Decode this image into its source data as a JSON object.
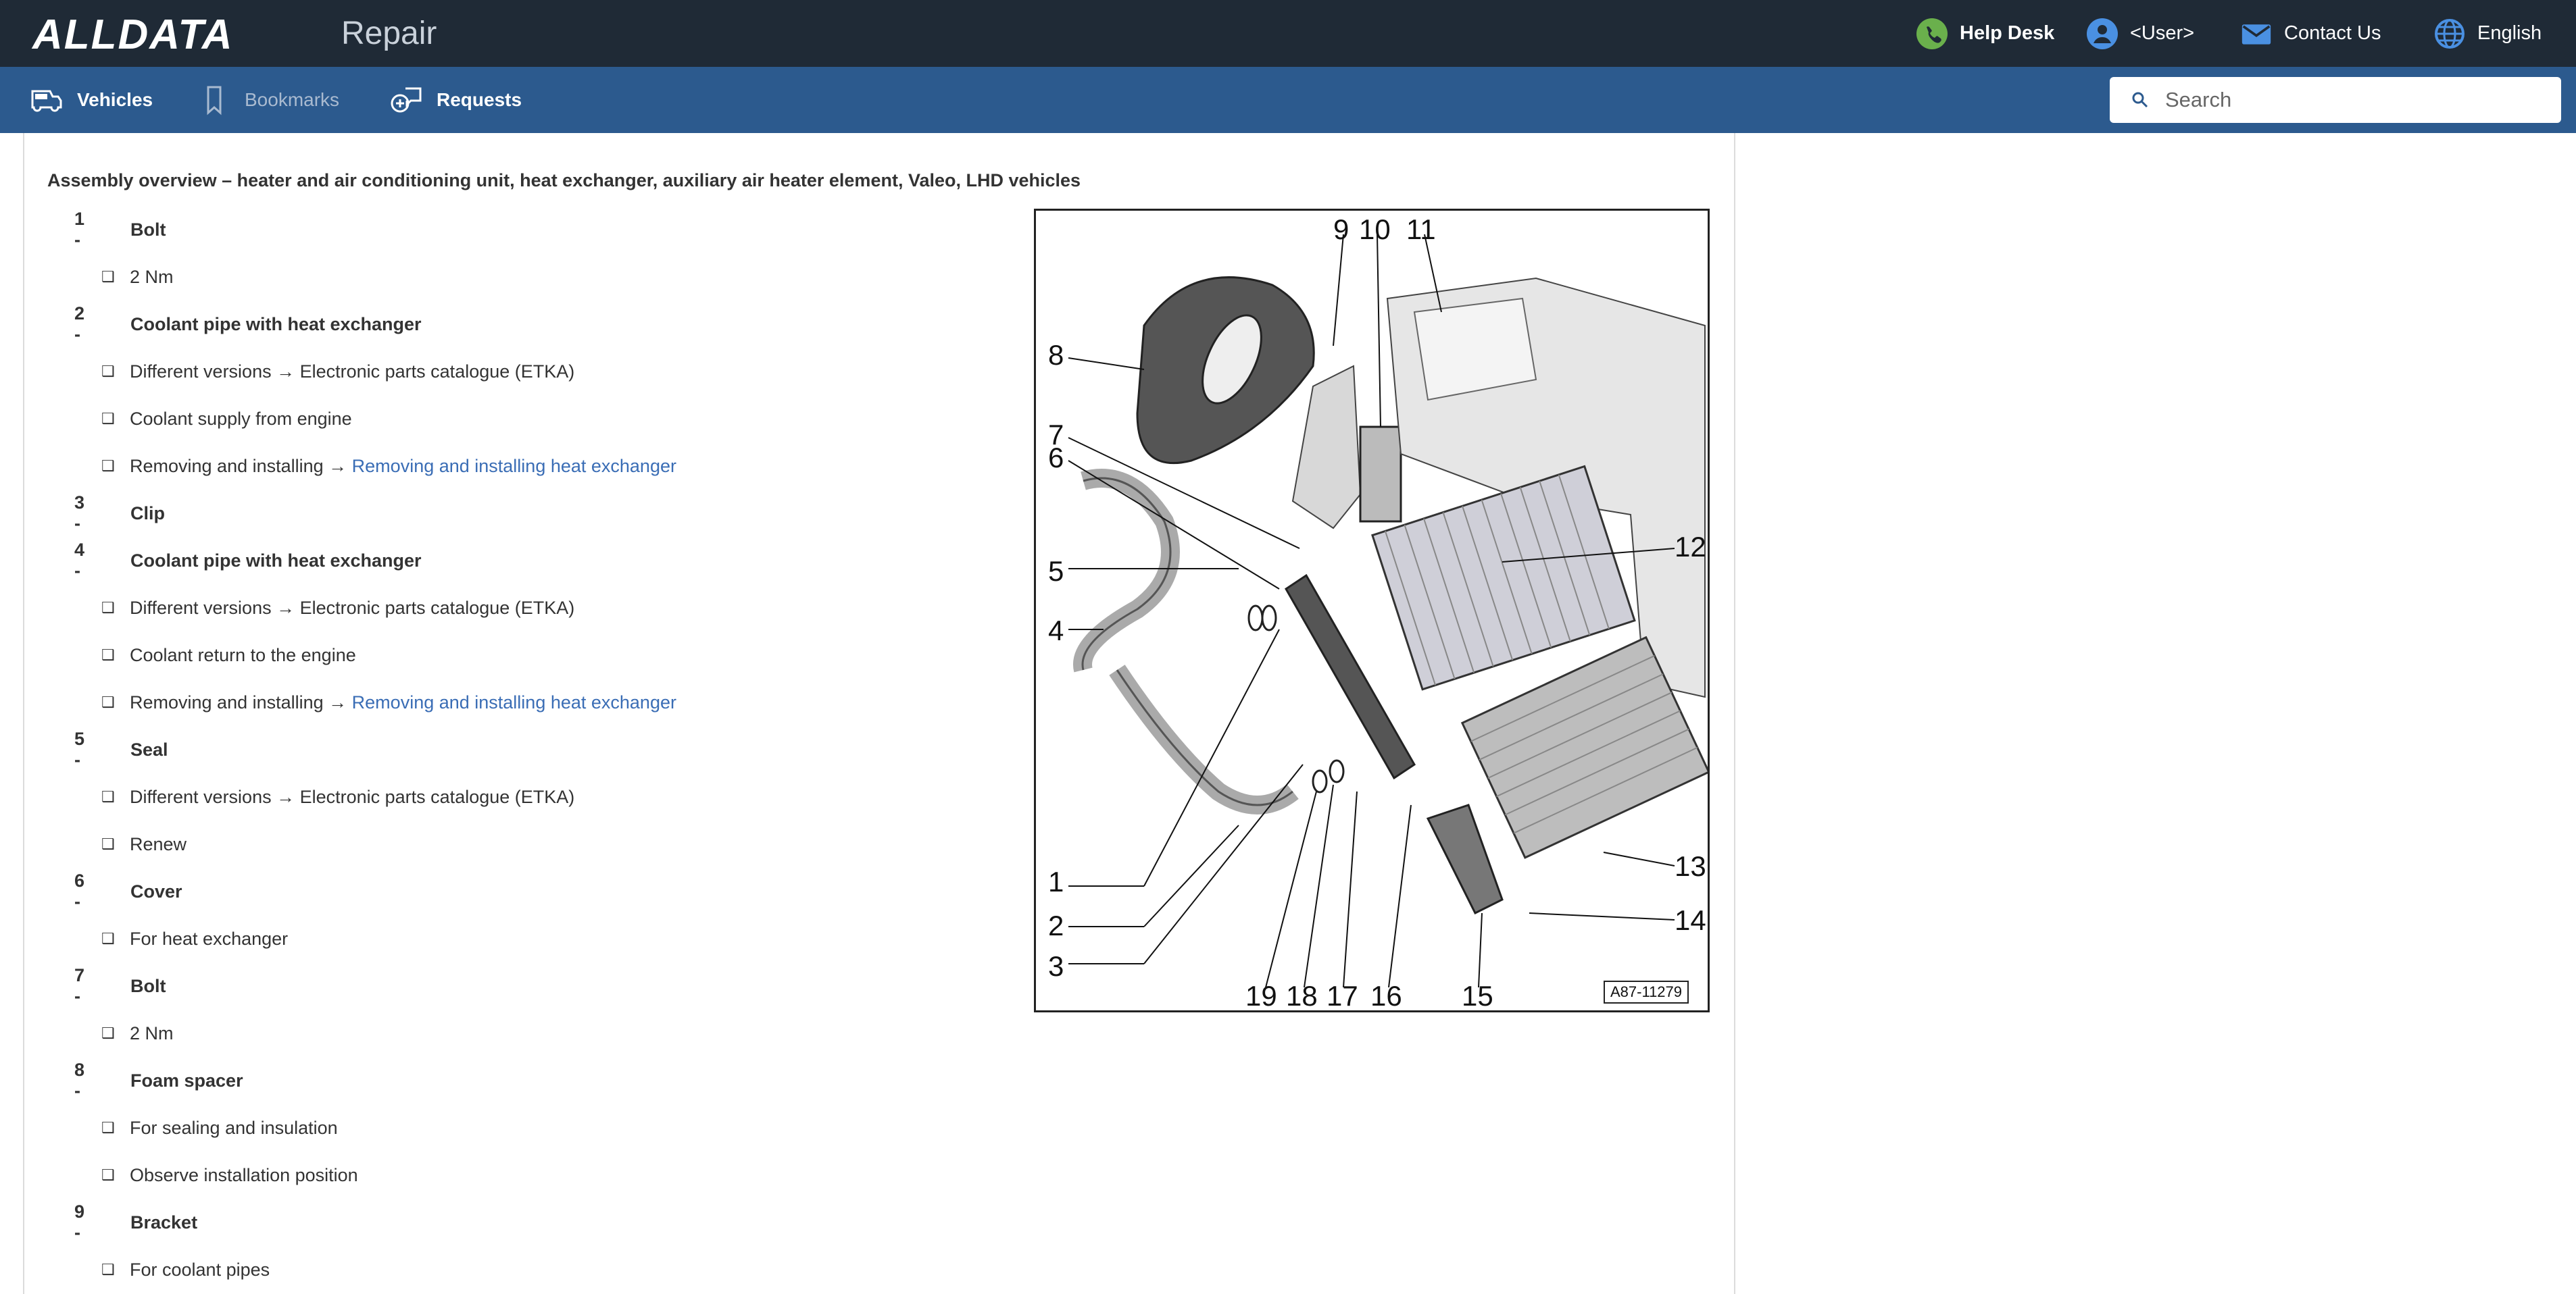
{
  "header": {
    "logo": "ALLDATA",
    "product": "Repair",
    "help_desk": "Help Desk",
    "user": "<User>",
    "contact_us": "Contact Us",
    "language": "English"
  },
  "nav": {
    "vehicles": "Vehicles",
    "bookmarks": "Bookmarks",
    "requests": "Requests",
    "search_placeholder": "Search"
  },
  "article": {
    "title": "Assembly overview – heater and air conditioning unit, heat exchanger, auxiliary air heater element, Valeo, LHD vehicles",
    "link_text": "Removing and installing heat exchanger",
    "items": [
      {
        "num": "1 -",
        "name": "Bolt",
        "subs": [
          "2 Nm"
        ]
      },
      {
        "num": "2 -",
        "name": "Coolant pipe with heat exchanger",
        "subs": [
          "Different versions → Electronic parts catalogue (ETKA)",
          "Coolant supply from engine",
          "Removing and installing → "
        ]
      },
      {
        "num": "3 -",
        "name": "Clip",
        "subs": []
      },
      {
        "num": "4 -",
        "name": "Coolant pipe with heat exchanger",
        "subs": [
          "Different versions → Electronic parts catalogue (ETKA)",
          "Coolant return to the engine",
          "Removing and installing → "
        ]
      },
      {
        "num": "5 -",
        "name": "Seal",
        "subs": [
          "Different versions → Electronic parts catalogue (ETKA)",
          "Renew"
        ]
      },
      {
        "num": "6 -",
        "name": "Cover",
        "subs": [
          "For heat exchanger"
        ]
      },
      {
        "num": "7 -",
        "name": "Bolt",
        "subs": [
          "2 Nm"
        ]
      },
      {
        "num": "8 -",
        "name": "Foam spacer",
        "subs": [
          "For sealing and insulation",
          "Observe installation position"
        ]
      },
      {
        "num": "9 -",
        "name": "Bracket",
        "subs": [
          "For coolant pipes"
        ]
      }
    ]
  },
  "figure": {
    "code": "A87-11279",
    "callouts": [
      "1",
      "2",
      "3",
      "4",
      "5",
      "6",
      "7",
      "8",
      "9",
      "10",
      "11",
      "12",
      "13",
      "14",
      "15",
      "16",
      "17",
      "18",
      "19"
    ]
  },
  "colors": {
    "topbar": "#1f2a36",
    "navbar": "#2c5a8e",
    "link": "#3a6db5",
    "help_icon": "#6ab04c",
    "user_icon": "#4a90e2"
  }
}
